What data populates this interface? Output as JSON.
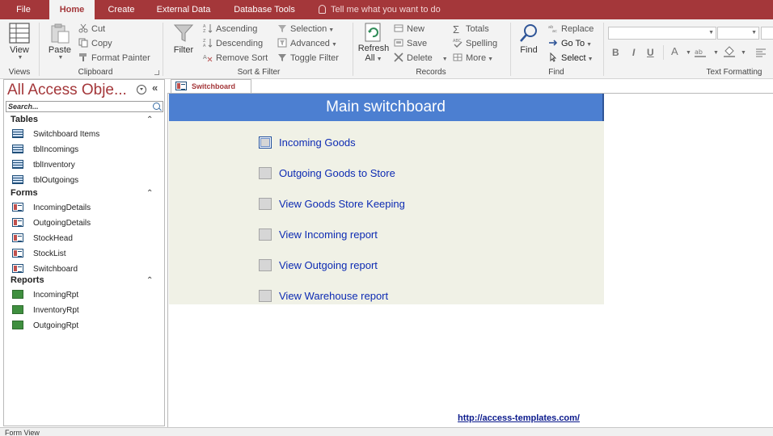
{
  "tabs": {
    "file": "File",
    "home": "Home",
    "create": "Create",
    "external_data": "External Data",
    "database_tools": "Database Tools",
    "tell_me": "Tell me what you want to do"
  },
  "ribbon": {
    "views": {
      "view": "View",
      "group": "Views"
    },
    "clipboard": {
      "paste": "Paste",
      "cut": "Cut",
      "copy": "Copy",
      "format_painter": "Format Painter",
      "group": "Clipboard"
    },
    "sort_filter": {
      "filter": "Filter",
      "ascending": "Ascending",
      "descending": "Descending",
      "remove_sort": "Remove Sort",
      "selection": "Selection",
      "advanced": "Advanced",
      "toggle_filter": "Toggle Filter",
      "group": "Sort & Filter"
    },
    "records": {
      "refresh": "Refresh",
      "refresh_all": "All",
      "new": "New",
      "save": "Save",
      "delete": "Delete",
      "totals": "Totals",
      "spelling": "Spelling",
      "more": "More",
      "group": "Records"
    },
    "find": {
      "find": "Find",
      "replace": "Replace",
      "go_to": "Go To",
      "select": "Select",
      "group": "Find"
    },
    "text_formatting": {
      "bold": "B",
      "italic": "I",
      "underline": "U",
      "font_color": "A",
      "group": "Text Formatting"
    }
  },
  "nav": {
    "title": "All Access Obje...",
    "search_placeholder": "Search...",
    "sections": [
      {
        "name": "Tables",
        "items": [
          "Switchboard Items",
          "tblIncomings",
          "tblInventory",
          "tblOutgoings"
        ]
      },
      {
        "name": "Forms",
        "items": [
          "IncomingDetails",
          "OutgoingDetails",
          "StockHead",
          "StockList",
          "Switchboard"
        ]
      },
      {
        "name": "Reports",
        "items": [
          "IncomingRpt",
          "InventoryRpt",
          "OutgoingRpt"
        ]
      }
    ]
  },
  "document": {
    "tab_label": "Switchboard",
    "header_title": "Main switchboard",
    "items": [
      "Incoming Goods",
      "Outgoing Goods to Store",
      "View Goods Store Keeping",
      "View Incoming report",
      "View Outgoing report",
      "View Warehouse report"
    ],
    "link": "http://access-templates.com/"
  },
  "status": {
    "text": "Form View"
  },
  "colors": {
    "accent": "#a4373a",
    "header_blue": "#4c7fd1",
    "detail_bg": "#f0f1e6",
    "link_blue": "#0d2bb3"
  }
}
